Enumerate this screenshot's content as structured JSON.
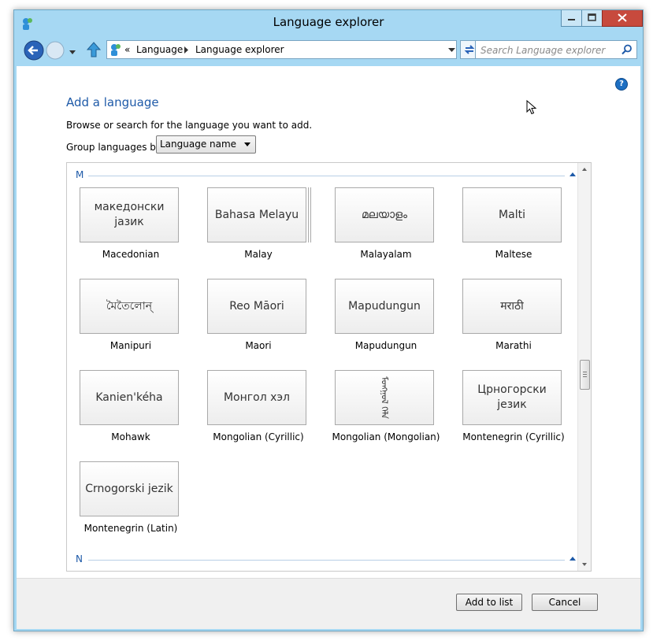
{
  "window": {
    "title": "Language explorer"
  },
  "address_bar": {
    "breadcrumb_prefix": "«",
    "crumbs": [
      "Language",
      "Language explorer"
    ]
  },
  "search": {
    "placeholder": "Search Language explorer"
  },
  "content": {
    "heading": "Add a language",
    "instructions": "Browse or search for the language you want to add.",
    "group_label": "Group languages by:",
    "group_by_value": "Language name",
    "help_icon": "?"
  },
  "groups": [
    {
      "letter": "M",
      "languages": [
        {
          "native": "македонски јазик",
          "name": "Macedonian"
        },
        {
          "native": "Bahasa Melayu",
          "name": "Malay",
          "stacked": true
        },
        {
          "native": "മലയാളം",
          "name": "Malayalam"
        },
        {
          "native": "Malti",
          "name": "Maltese"
        },
        {
          "native": "মৈতৈলোন্",
          "name": "Manipuri"
        },
        {
          "native": "Reo Māori",
          "name": "Maori"
        },
        {
          "native": "Mapudungun",
          "name": "Mapudungun"
        },
        {
          "native": "मराठी",
          "name": "Marathi"
        },
        {
          "native": "Kanien'kéha",
          "name": "Mohawk"
        },
        {
          "native": "Монгол хэл",
          "name": "Mongolian (Cyrillic)"
        },
        {
          "native": "ᠮᠣᠩᠭᠣᠯ ᠬᠡᠯᠡ",
          "name": "Mongolian (Mongolian)",
          "vertical": true
        },
        {
          "native": "Црногорски језик",
          "name": "Montenegrin (Cyrillic)"
        },
        {
          "native": "Crnogorski jezik",
          "name": "Montenegrin (Latin)"
        }
      ]
    },
    {
      "letter": "N",
      "languages": []
    }
  ],
  "buttons": {
    "add": "Add to list",
    "cancel": "Cancel"
  },
  "colors": {
    "window_frame": "#a6d8f3",
    "heading": "#1e5aa8",
    "close_button": "#c74a3d"
  },
  "icons": {
    "back": "back-arrow-icon",
    "forward": "forward-arrow-icon",
    "up": "up-arrow-icon",
    "refresh": "refresh-icon",
    "search": "magnifier-icon",
    "help": "help-icon"
  }
}
